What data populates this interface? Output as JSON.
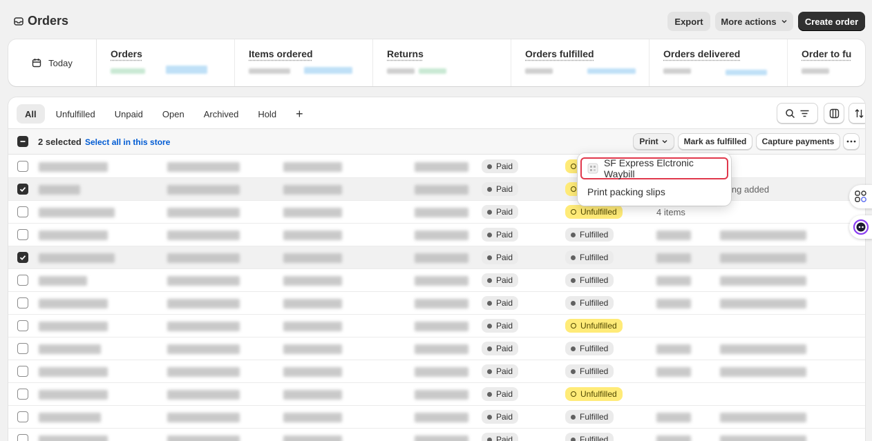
{
  "page": {
    "title": "Orders"
  },
  "header": {
    "export_label": "Export",
    "more_actions_label": "More actions",
    "create_order_label": "Create order"
  },
  "metrics": {
    "date_range_label": "Today",
    "items": [
      "Orders",
      "Items ordered",
      "Returns",
      "Orders fulfilled",
      "Orders delivered",
      "Order to fu"
    ]
  },
  "tabs": [
    "All",
    "Unfulfilled",
    "Unpaid",
    "Open",
    "Archived",
    "Hold"
  ],
  "add_view_label": "+",
  "bulk": {
    "selected_label": "2 selected",
    "select_all_label": "Select all in this store",
    "print_label": "Print",
    "mark_fulfilled_label": "Mark as fulfilled",
    "capture_payments_label": "Capture payments"
  },
  "print_menu": {
    "items": [
      "SF Express Elctronic Waybill",
      "Print packing slips"
    ]
  },
  "rows": [
    {
      "checked": false,
      "payment": "Paid",
      "fulfillment": "Unfulfilled",
      "note": ""
    },
    {
      "checked": true,
      "payment": "Paid",
      "fulfillment": "Unfulfilled",
      "note": "Tracking added"
    },
    {
      "checked": false,
      "payment": "Paid",
      "fulfillment": "Unfulfilled",
      "note": "4 items"
    },
    {
      "checked": false,
      "payment": "Paid",
      "fulfillment": "Fulfilled",
      "note": ""
    },
    {
      "checked": true,
      "payment": "Paid",
      "fulfillment": "Fulfilled",
      "note": ""
    },
    {
      "checked": false,
      "payment": "Paid",
      "fulfillment": "Fulfilled",
      "note": ""
    },
    {
      "checked": false,
      "payment": "Paid",
      "fulfillment": "Fulfilled",
      "note": ""
    },
    {
      "checked": false,
      "payment": "Paid",
      "fulfillment": "Unfulfilled",
      "note": ""
    },
    {
      "checked": false,
      "payment": "Paid",
      "fulfillment": "Fulfilled",
      "note": ""
    },
    {
      "checked": false,
      "payment": "Paid",
      "fulfillment": "Fulfilled",
      "note": ""
    },
    {
      "checked": false,
      "payment": "Paid",
      "fulfillment": "Unfulfilled",
      "note": ""
    },
    {
      "checked": false,
      "payment": "Paid",
      "fulfillment": "Fulfilled",
      "note": ""
    },
    {
      "checked": false,
      "payment": "Paid",
      "fulfillment": "Fulfilled",
      "note": ""
    }
  ],
  "colors": {
    "primary_button": "#303030",
    "unfulfilled_badge": "#ffeb78",
    "highlight_border": "#e0374b",
    "link": "#005bd3"
  }
}
